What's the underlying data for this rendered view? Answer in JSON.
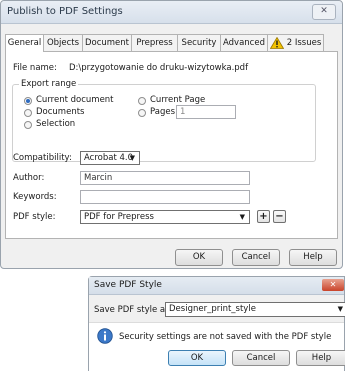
{
  "window": {
    "title": "Publish to PDF Settings",
    "close_symbol": "✕"
  },
  "tabs": [
    {
      "label": "General"
    },
    {
      "label": "Objects"
    },
    {
      "label": "Document"
    },
    {
      "label": "Prepress"
    },
    {
      "label": "Security"
    },
    {
      "label": "Advanced"
    },
    {
      "label": "2 Issues",
      "icon": "warning-icon"
    }
  ],
  "general": {
    "file_name_label": "File name:",
    "file_name_value": "D:\\przygotowanie do druku-wizytowka.pdf",
    "export_range_label": "Export range",
    "current_document_label": "Current document",
    "documents_label": "Documents",
    "selection_label": "Selection",
    "current_page_label": "Current Page",
    "pages_label": "Pages:",
    "pages_value": "1",
    "compatibility_label": "Compatibility:",
    "compatibility_value": "Acrobat 4.0",
    "author_label": "Author:",
    "author_value": "Marcin",
    "keywords_label": "Keywords:",
    "keywords_value": "",
    "pdf_style_label": "PDF style:",
    "pdf_style_value": "PDF for Prepress",
    "add_style_symbol": "+",
    "remove_style_symbol": "−"
  },
  "buttons": {
    "ok": "OK",
    "cancel": "Cancel",
    "help": "Help"
  },
  "save_dialog": {
    "title": "Save PDF Style",
    "close_symbol": "✕",
    "save_as_label": "Save PDF style as:",
    "save_as_value": "Designer_print_style",
    "info_text": "Security settings are not saved with the PDF style",
    "ok": "OK",
    "cancel": "Cancel",
    "help": "Help"
  },
  "colors": {
    "accent": "#2d6bc0",
    "warning": "#f2c200",
    "dialog_close": "#c9432a"
  }
}
